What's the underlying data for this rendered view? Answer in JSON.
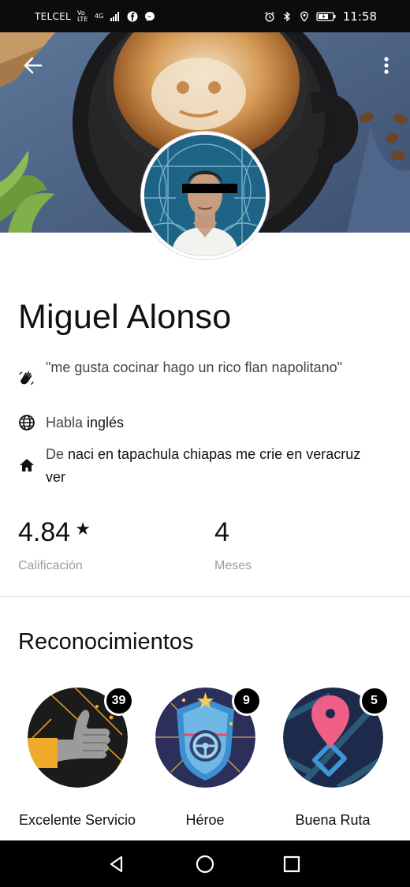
{
  "status_bar": {
    "carrier": "TELCEL",
    "network_1": "Vo LTE",
    "network_2": "4G",
    "time": "11:58",
    "icons": [
      "signal-icon",
      "facebook-icon",
      "messenger-icon",
      "alarm-icon",
      "bluetooth-icon",
      "location-icon",
      "battery-icon"
    ]
  },
  "header": {
    "back_icon": "arrow-left-icon",
    "menu_icon": "more-vertical-icon"
  },
  "profile": {
    "name": "Miguel Alonso",
    "quote": "\"me gusta cocinar hago un rico flan napolitano\"",
    "language_prefix": "Habla ",
    "language": "inglés",
    "origin_prefix": "De ",
    "origin": "naci en tapachula chiapas me crie en veracruz ver"
  },
  "stats": {
    "rating_value": "4.84",
    "rating_label": "Calificación",
    "months_value": "4",
    "months_label": "Meses"
  },
  "recognitions": {
    "title": "Reconocimientos",
    "items": [
      {
        "label": "Excelente Servicio",
        "count": "39",
        "icon": "thumbs-up-icon"
      },
      {
        "label": "Héroe",
        "count": "9",
        "icon": "hero-shield-icon"
      },
      {
        "label": "Buena Ruta",
        "count": "5",
        "icon": "map-pin-icon"
      }
    ]
  },
  "nav_bar": {
    "icons": [
      "back-triangle-icon",
      "home-circle-icon",
      "recents-square-icon"
    ]
  },
  "colors": {
    "status_bar": "#0c0c0c",
    "badge_bg": "#1b1b1b",
    "accent_gold": "#f0a928",
    "hero_blue": "#2c2f5a",
    "route_navy": "#1d2a4b",
    "pin_pink": "#ef5e86"
  }
}
